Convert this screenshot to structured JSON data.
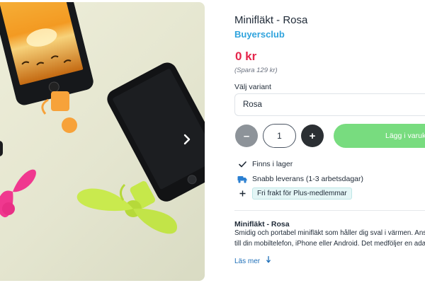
{
  "product": {
    "title": "Minifläkt - Rosa",
    "brand": "Buyersclub",
    "price": "0 kr",
    "save_note": "(Spara 129 kr)"
  },
  "variant": {
    "label": "Välj variant",
    "selected": "Rosa"
  },
  "quantity": {
    "minus_symbol": "–",
    "value": "1",
    "plus_symbol": "+"
  },
  "cart": {
    "add_label": "Lägg i varukorg"
  },
  "features": {
    "stock": {
      "text": "Finns i lager",
      "icon": "check-icon"
    },
    "delivery": {
      "text": "Snabb leverans (1-3 arbetsdagar)",
      "icon": "truck-icon"
    },
    "shipping": {
      "text": "Fri frakt för Plus-medlemmar",
      "icon": "plus-icon"
    }
  },
  "description": {
    "title": "Minifläkt - Rosa",
    "line1": "Smidig och portabel minifläkt som håller dig sval i värmen. Ansluts",
    "line2": "till din mobiltelefon, iPhone eller Android. Det medföljer en adapter",
    "read_more": "Läs mer",
    "read_more_icon": "arrow-down-icon"
  },
  "gallery": {
    "next_icon": "chevron-right-icon"
  },
  "colors": {
    "brand": "#2fa3dd",
    "price": "#e5264c",
    "cart_button": "#78dc7f",
    "minus_button": "#8d9399",
    "plus_button": "#2b2f33",
    "link": "#1e6fb8",
    "badge_bg": "#e4f6f6"
  }
}
